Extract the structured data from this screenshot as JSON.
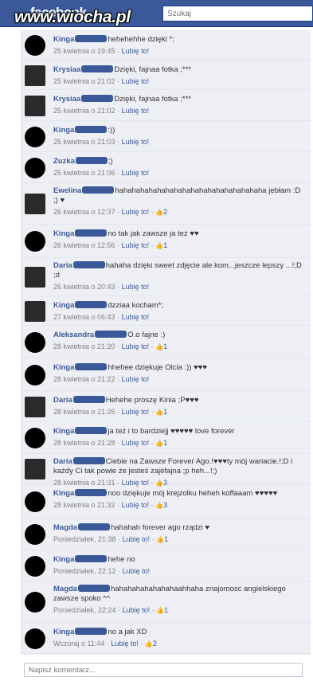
{
  "header": {
    "logo": "facebook",
    "watermark": "www.wiocha.pl",
    "search_placeholder": "Szukaj"
  },
  "comments": [
    {
      "author": "Kinga",
      "text": "hehehehhe dzięki *;",
      "time": "25 kwietnia o 19:45",
      "like": "Lubię to!",
      "likes": ""
    },
    {
      "author": "Krysiaa",
      "text": "Dzięki, fajnaa fotka ;***",
      "time": "25 kwietnia o 21:02",
      "like": "Lubię to!",
      "likes": ""
    },
    {
      "author": "Krysiaa",
      "text": "Dzięki, fajnaa fotka ;***",
      "time": "25 kwietnia o 21:02",
      "like": "Lubię to!",
      "likes": ""
    },
    {
      "author": "Kinga",
      "text": ":))",
      "time": "25 kwietnia o 21:03",
      "like": "Lubię to!",
      "likes": ""
    },
    {
      "author": "Zuzka",
      "text": ";)",
      "time": "25 kwietnia o 21:06",
      "like": "Lubię to!",
      "likes": ""
    },
    {
      "author": "Ewelina",
      "text": "hahahahahahahahahahahahahahahahahaha jebłam :D ;) ♥",
      "time": "26 kwietnia o 12:37",
      "like": "Lubię to!",
      "likes": "2"
    },
    {
      "author": "Kinga",
      "text": "no tak jak zawsze ja też ♥♥",
      "time": "26 kwietnia o 12:56",
      "like": "Lubię to!",
      "likes": "1"
    },
    {
      "author": "Daria",
      "text": "hahaha dzięki sweet zdjęcie ale kom...jeszcze lepszy ...!;D ;d",
      "time": "26 kwietnia o 20:43",
      "like": "Lubię to!",
      "likes": ""
    },
    {
      "author": "Kinga",
      "text": "dzziaa kocham*;",
      "time": "27 kwietnia o 06:43",
      "like": "Lubię to!",
      "likes": ""
    },
    {
      "author": "Aleksandra",
      "text": "O.o fajne :)",
      "time": "28 kwietnia o 21:20",
      "like": "Lubię to!",
      "likes": "1"
    },
    {
      "author": "Kinga",
      "text": "hhehee dziękuje Olcia :)) ♥♥♥",
      "time": "28 kwietnia o 21:22",
      "like": "Lubię to!",
      "likes": ""
    },
    {
      "author": "Daria",
      "text": "Hehehe proszę Kinia ;P♥♥♥",
      "time": "28 kwietnia o 21:26",
      "like": "Lubię to!",
      "likes": "1"
    },
    {
      "author": "Kinga",
      "text": "ja też i to bardziejj ♥♥♥♥♥ love forever",
      "time": "28 kwietnia o 21:28",
      "like": "Lubię to!",
      "likes": "1"
    },
    {
      "author": "Daria",
      "text": "Ciebie na Zawsze Forever Ago.!♥♥♥ty mój wariacie.!;D i każdy Ci tak powie że jesteś zajefajna ;p heh...!;)",
      "time": "28 kwietnia o 21:31",
      "like": "Lubię to!",
      "likes": "3"
    },
    {
      "author": "Kinga",
      "text": "noo dziękuje mój krejzolku heheh koffaaam ♥♥♥♥♥",
      "time": "28 kwietnia o 21:32",
      "like": "Lubię to!",
      "likes": "3"
    },
    {
      "author": "Magda",
      "text": "hahahah forever ago rządzi ♥",
      "time": "Poniedziałek, 21:38",
      "like": "Lubię to!",
      "likes": "1"
    },
    {
      "author": "Kinga",
      "text": "hehe no",
      "time": "Poniedziałek, 22:12",
      "like": "Lubię to!",
      "likes": ""
    },
    {
      "author": "Magda",
      "text": "hahahahahahahahaahhaha znajomosc angielskiego zawsze spoko ^^",
      "time": "Poniedziałek, 22:24",
      "like": "Lubię to!",
      "likes": "1"
    },
    {
      "author": "Kinga",
      "text": "no a jak XD",
      "time": "Wczoraj o 11:44",
      "like": "Lubię to!",
      "likes": "2"
    }
  ],
  "composer": {
    "placeholder": "Napisz komentarz..."
  },
  "colors": {
    "brand": "#3b5998",
    "feed_bg": "#edeff4"
  }
}
